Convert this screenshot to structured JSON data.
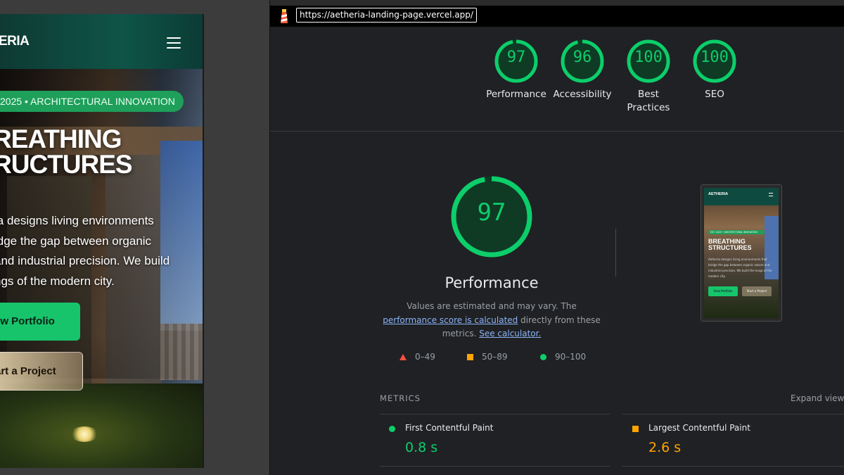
{
  "preview": {
    "logo": "ERIA",
    "badge": "2025 • ARCHITECTURAL INNOVATION",
    "title_lines": [
      "REATHING",
      "RUCTURES"
    ],
    "paragraph_lines": [
      "ia designs living environments",
      "idge the gap between organic",
      " and industrial precision. We build",
      "ngs of the modern city."
    ],
    "button_primary": "ew Portfolio",
    "button_secondary": "art a Project"
  },
  "report": {
    "url": "https://aetheria-landing-page.vercel.app/",
    "gauges": [
      {
        "score": 97,
        "label": "Performance"
      },
      {
        "score": 96,
        "label": "Accessibility"
      },
      {
        "score": 100,
        "label": "Best Practices"
      },
      {
        "score": 100,
        "label": "SEO"
      }
    ],
    "performance": {
      "score": 97,
      "title": "Performance",
      "desc_prefix": "Values are estimated and may vary. The ",
      "desc_link1": "performance score is calculated",
      "desc_middle": " directly from these metrics. ",
      "desc_link2": "See calculator."
    },
    "thumbnail": {
      "logo": "AETHERIA",
      "badge": "EST. 2025 • ARCHITECTURAL INNOVATION",
      "title_lines": [
        "BREATHING",
        "STRUCTURES"
      ],
      "paragraph": "Aetheria designs living environments that bridge the gap between organic nature and industrial precision. We build the lungs of the modern city.",
      "button_primary": "View Portfolio",
      "button_secondary": "Start a Project"
    },
    "legend": [
      {
        "shape": "triangle",
        "range": "0–49",
        "color": "#ff4e42"
      },
      {
        "shape": "square",
        "range": "50–89",
        "color": "#ffa400"
      },
      {
        "shape": "circle",
        "range": "90–100",
        "color": "#0cce6b"
      }
    ],
    "metrics_heading": "METRICS",
    "expand_view": "Expand view",
    "metrics": [
      {
        "name": "First Contentful Paint",
        "value": "0.8 s",
        "status": "pass",
        "color": "#0cce6b"
      },
      {
        "name": "Largest Contentful Paint",
        "value": "2.6 s",
        "status": "average",
        "color": "#ffa400"
      }
    ]
  },
  "colors": {
    "pass": "#0cce6b",
    "average": "#ffa400",
    "fail": "#ff4e42",
    "brand_green": "#17c46b"
  }
}
